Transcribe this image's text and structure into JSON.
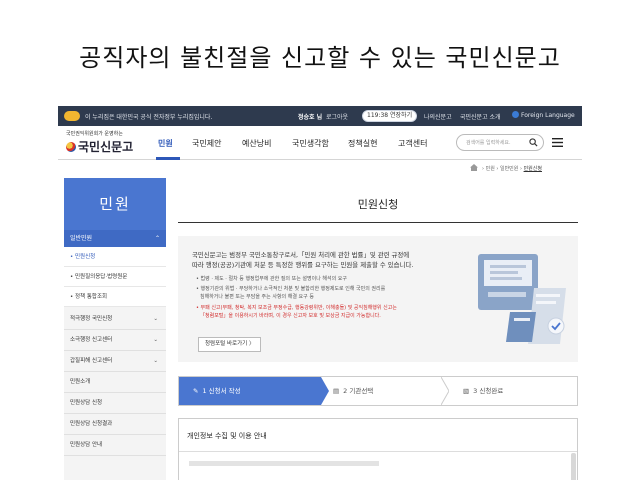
{
  "slide": {
    "title": "공직자의 불친절을 신고할 수 있는 국민신문고"
  },
  "gov_bar": {
    "notice": "이 누리집은 대한민국 공식 전자정부 누리집입니다.",
    "user": "정승호 님",
    "logout": "로그아웃",
    "timer": "119:38 연장하기",
    "myinfo": "나의신문고",
    "about": "국민신문고 소개",
    "language": "Foreign Language"
  },
  "header": {
    "logo_sub": "국민권익위원회가 운영하는",
    "logo_main": "국민신문고",
    "nav": [
      "민원",
      "국민제안",
      "예산낭비",
      "국민생각함",
      "정책실현",
      "고객센터"
    ],
    "active_nav": "민원",
    "search_placeholder": "검색어를 입력하세요."
  },
  "breadcrumb": [
    "민원",
    "일반민원",
    "민원신청"
  ],
  "sidebar": {
    "title": "민원",
    "group": "일반민원",
    "sub_items": [
      "• 민원신청",
      "• 민원질의응답·법령원문",
      "• 정책 통합조회"
    ],
    "items": [
      "적극행정 국민신청",
      "소극행정 신고센터",
      "갑질피해 신고센터",
      "민원소개",
      "민원상담 신청",
      "민원상담 신청결과",
      "민원상담 안내"
    ]
  },
  "main": {
    "page_title": "민원신청",
    "intro_line1": "국민신문고는 범정부 국민소통창구로서,「민원 처리에 관한 법률」및 관련 규정에",
    "intro_line2": "따라 행정(공공)기관에 처분 등 특정한 행위를 요구하는 민원을 제출할 수 있습니다.",
    "bullets": [
      "• 법령 · 제도 · 절차 등 행정업무에 관한 질의 또는 설명이나 해석의 요구",
      "• 행정기관의 위법 · 부당하거나 소극적인 처분 및 불합리한 행정제도로 인해 국민의 권리를",
      "  침해하거나 불편 또는 부담을 주는 사항의 해결 요구 등"
    ],
    "red_notes": [
      "• 부패 신고(부패, 청탁, 복지 보조금 부정수급, 행동강령위반, 이해충돌) 및 공익침해행위 신고는",
      "「청렴포털」을 이용하시기 바라며, 이 경우 신고자 보호 및 보상금 지급이 가능합니다."
    ],
    "portal_button": "청렴포털 바로가기 〉",
    "steps": [
      "1 신청서 작성",
      "2 기관선택",
      "3 신청완료"
    ],
    "section_title": "개인정보 수집 및 이용 안내"
  },
  "colors": {
    "accent": "#4a76d0",
    "nav_active": "#2d57b8",
    "top_bar": "#2e3a4e",
    "warning": "#d22d2d"
  },
  "icons": [
    "search-icon",
    "menu-icon",
    "home-icon",
    "chevron-up-icon",
    "chevron-down-icon",
    "pencil-icon",
    "building-icon",
    "document-check-icon",
    "globe-icon"
  ]
}
